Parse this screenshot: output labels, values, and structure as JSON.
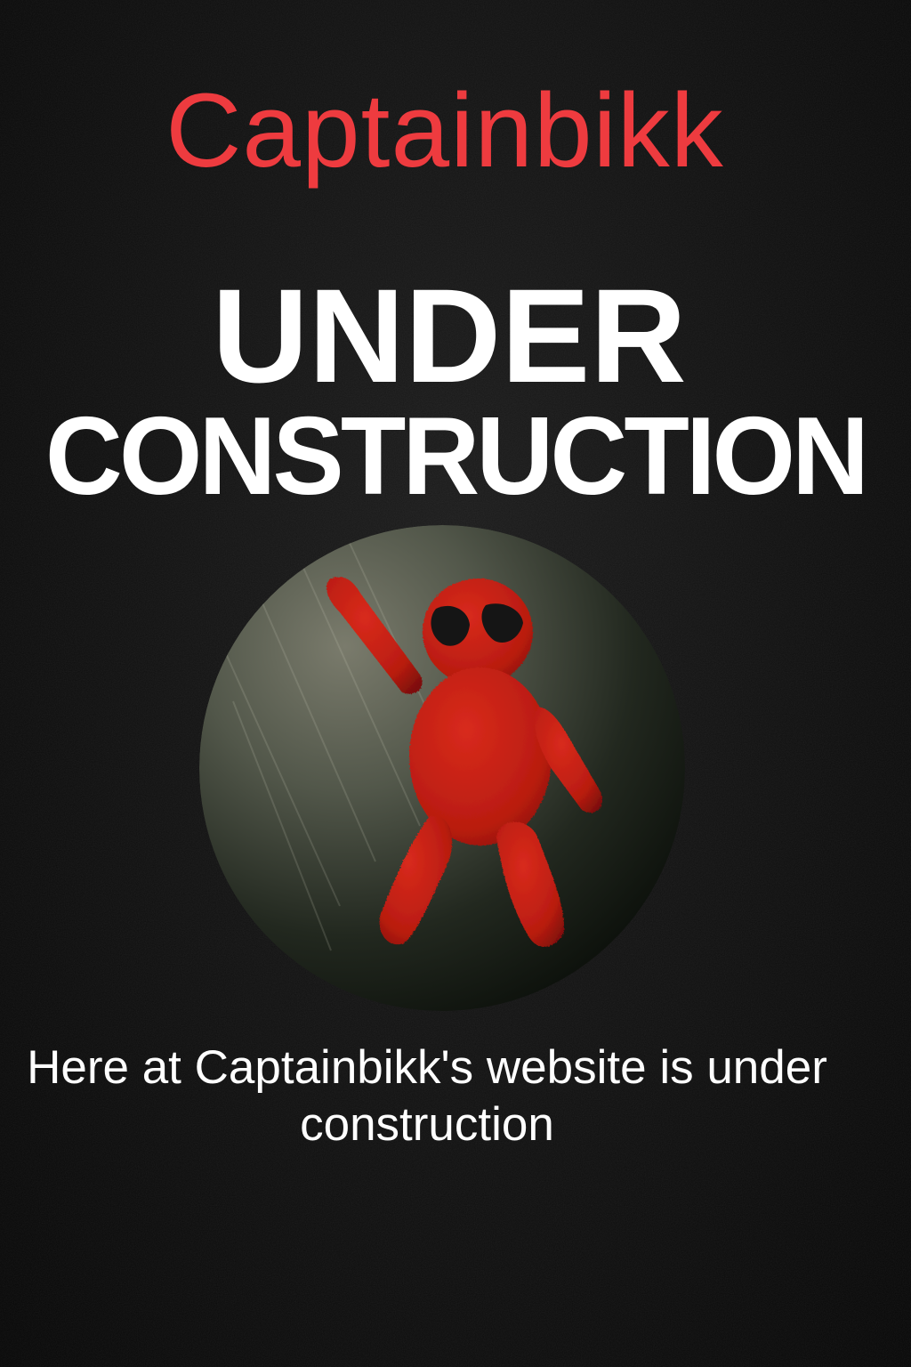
{
  "header": {
    "brand": "Captainbikk"
  },
  "hero": {
    "headline_line1": "UNDER",
    "headline_line2": "CONSTRUCTION"
  },
  "image": {
    "subject": "red-felt-figure-icon"
  },
  "message": {
    "caption": "Here at Captainbikk's website is under construction"
  },
  "colors": {
    "background": "#0d0d0d",
    "brand_red": "#ee3b3f",
    "headline": "#ffffff",
    "figure_red": "#c81e12",
    "circle_gray": "#6f7064"
  }
}
